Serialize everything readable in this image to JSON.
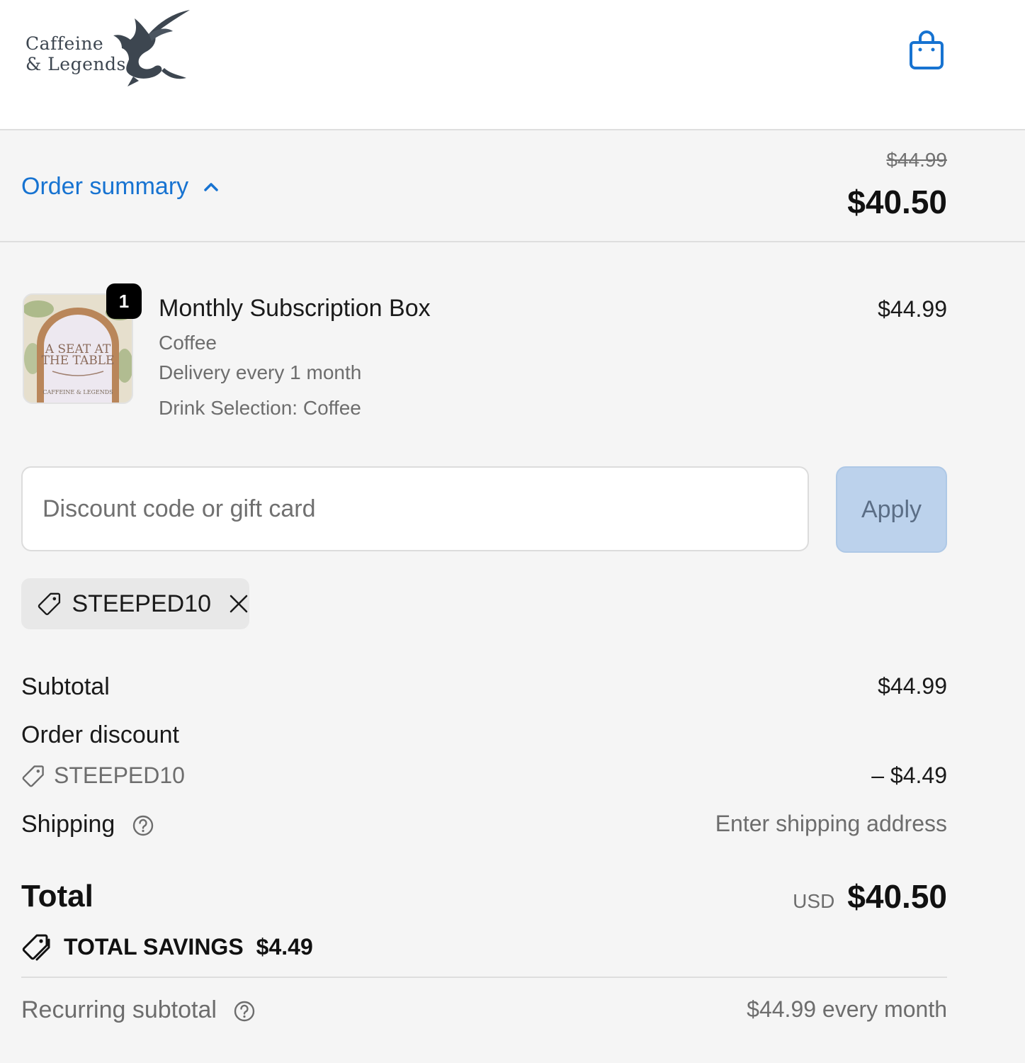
{
  "header": {
    "logo_line1": "Caffeine",
    "logo_line2": "& Legends",
    "cart_icon": "shopping-bag-icon"
  },
  "summary_bar": {
    "toggle_label": "Order summary",
    "toggle_icon": "chevron-up-icon",
    "original_price": "$44.99",
    "discounted_price": "$40.50"
  },
  "line_item": {
    "quantity": "1",
    "title": "Monthly Subscription Box",
    "variant": "Coffee",
    "delivery": "Delivery every 1 month",
    "selection": "Drink Selection: Coffee",
    "price": "$44.99",
    "thumbnail_text": "A SEAT AT THE TABLE",
    "thumbnail_brand": "CAFFEINE & LEGENDS"
  },
  "discount": {
    "placeholder": "Discount code or gift card",
    "value": "",
    "apply_label": "Apply"
  },
  "applied_code": {
    "code": "STEEPED10",
    "icon": "tag-icon",
    "remove_icon": "close-icon"
  },
  "totals": {
    "subtotal_label": "Subtotal",
    "subtotal_value": "$44.99",
    "order_discount_label": "Order discount",
    "discount_code": "STEEPED10",
    "discount_value": "– $4.49",
    "shipping_label": "Shipping",
    "shipping_value": "Enter shipping address",
    "total_label": "Total",
    "currency": "USD",
    "total_value": "$40.50",
    "savings_label": "TOTAL SAVINGS",
    "savings_value": "$4.49",
    "recurring_label": "Recurring subtotal",
    "recurring_value": "$44.99 every month"
  },
  "colors": {
    "link": "#1773d1",
    "background": "#f5f5f5",
    "apply_button": "#bcd2ec",
    "badge": "#000000"
  }
}
